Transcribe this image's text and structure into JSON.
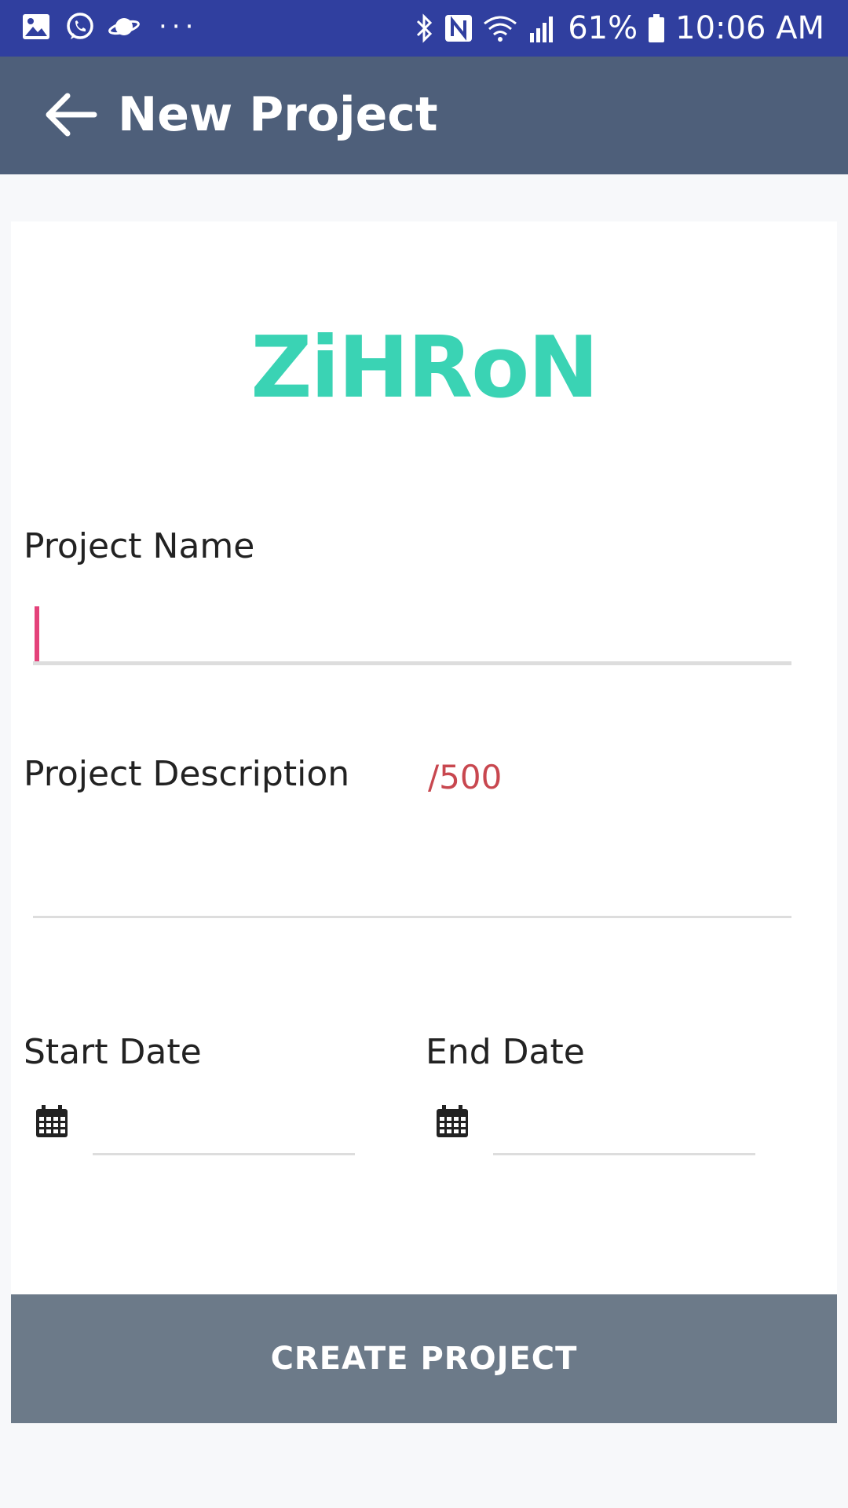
{
  "status_bar": {
    "battery_percent": "61%",
    "time": "10:06 AM",
    "left_icons": [
      "gallery-icon",
      "whatsapp-icon",
      "planet-icon"
    ],
    "overflow": "···",
    "right_icons": [
      "bluetooth-icon",
      "nfc-icon",
      "wifi-icon",
      "signal-icon",
      "battery-icon"
    ]
  },
  "app_bar": {
    "title": "New Project",
    "back_icon": "arrow-left-icon"
  },
  "brand": {
    "logo_text": "ZiHRoN",
    "logo_color": "#3ad3b4"
  },
  "form": {
    "project_name_label": "Project Name",
    "project_name_value": "",
    "project_description_label": "Project Description",
    "description_counter": "/500",
    "project_description_value": "",
    "start_date_label": "Start Date",
    "start_date_value": "",
    "end_date_label": "End Date",
    "end_date_value": "",
    "date_icon": "calendar-icon"
  },
  "actions": {
    "create_label": "CREATE  PROJECT"
  },
  "colors": {
    "status_bar": "#303f9f",
    "app_bar": "#4e5f7a",
    "button": "#6c7a89",
    "cursor": "#e4427a",
    "counter": "#c8474f"
  }
}
